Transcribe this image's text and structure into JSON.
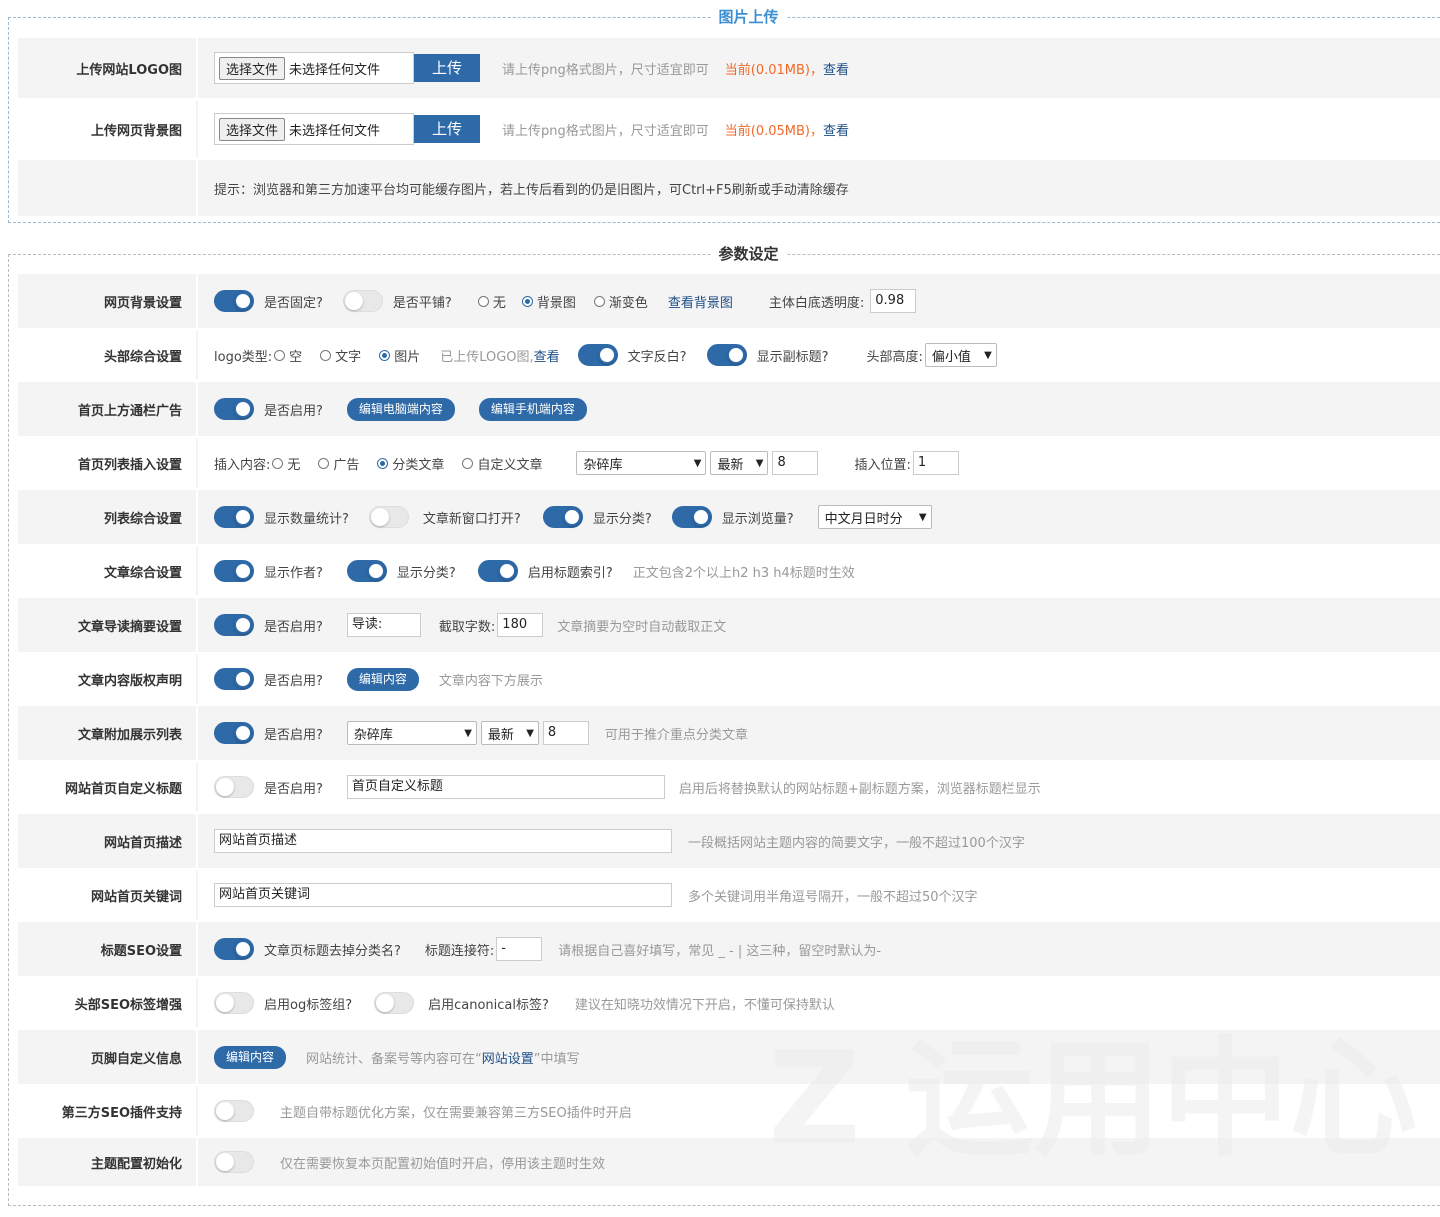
{
  "upload": {
    "legend": "图片上传",
    "logo": {
      "label": "上传网站LOGO图",
      "choose": "选择文件",
      "none": "未选择任何文件",
      "upload": "上传",
      "hint": "请上传png格式图片，尺寸适宜即可",
      "current": "当前(0.01MB)，",
      "view": "查看"
    },
    "bg": {
      "label": "上传网页背景图",
      "choose": "选择文件",
      "none": "未选择任何文件",
      "upload": "上传",
      "hint": "请上传png格式图片，尺寸适宜即可",
      "current": "当前(0.05MB)，",
      "view": "查看"
    },
    "tip": "提示：浏览器和第三方加速平台均可能缓存图片，若上传后看到的仍是旧图片，可Ctrl+F5刷新或手动清除缓存"
  },
  "params": {
    "legend": "参数设定",
    "r1": {
      "label": "网页背景设置",
      "fixed": "是否固定?",
      "tile": "是否平铺?",
      "none": "无",
      "img": "背景图",
      "grad": "渐变色",
      "view": "查看背景图",
      "opacity_label": "主体白底透明度:",
      "opacity": "0.98"
    },
    "r2": {
      "label": "头部综合设置",
      "logo_type": "logo类型:",
      "empty": "空",
      "text": "文字",
      "img": "图片",
      "uploaded": "已上传LOGO图,",
      "view": "查看",
      "invert": "文字反白?",
      "subtitle": "显示副标题?",
      "height_label": "头部高度:",
      "height": "偏小值"
    },
    "r3": {
      "label": "首页上方通栏广告",
      "enable": "是否启用?",
      "pc": "编辑电脑端内容",
      "mobile": "编辑手机端内容"
    },
    "r4": {
      "label": "首页列表插入设置",
      "insert": "插入内容:",
      "none": "无",
      "ad": "广告",
      "cat": "分类文章",
      "custom": "自定义文章",
      "category": "杂碎库",
      "order": "最新",
      "count": "8",
      "pos_label": "插入位置:",
      "pos": "1"
    },
    "r5": {
      "label": "列表综合设置",
      "stats": "显示数量统计?",
      "newwin": "文章新窗口打开?",
      "cat": "显示分类?",
      "views": "显示浏览量?",
      "datefmt": "中文月日时分"
    },
    "r6": {
      "label": "文章综合设置",
      "author": "显示作者?",
      "cat": "显示分类?",
      "toc": "启用标题索引?",
      "hint": "正文包含2个以上h2 h3 h4标题时生效"
    },
    "r7": {
      "label": "文章导读摘要设置",
      "enable": "是否启用?",
      "lead": "导读:",
      "len_label": "截取字数:",
      "len": "180",
      "hint": "文章摘要为空时自动截取正文"
    },
    "r8": {
      "label": "文章内容版权声明",
      "enable": "是否启用?",
      "edit": "编辑内容",
      "hint": "文章内容下方展示"
    },
    "r9": {
      "label": "文章附加展示列表",
      "enable": "是否启用?",
      "category": "杂碎库",
      "order": "最新",
      "count": "8",
      "hint": "可用于推介重点分类文章"
    },
    "r10": {
      "label": "网站首页自定义标题",
      "enable": "是否启用?",
      "value": "首页自定义标题",
      "hint": "启用后将替换默认的网站标题+副标题方案，浏览器标题栏显示"
    },
    "r11": {
      "label": "网站首页描述",
      "value": "网站首页描述",
      "hint": "一段概括网站主题内容的简要文字，一般不超过100个汉字"
    },
    "r12": {
      "label": "网站首页关键词",
      "value": "网站首页关键词",
      "hint": "多个关键词用半角逗号隔开，一般不超过50个汉字"
    },
    "r13": {
      "label": "标题SEO设置",
      "strip": "文章页标题去掉分类名?",
      "sep_label": "标题连接符:",
      "sep": "-",
      "hint": "请根据自己喜好填写，常见 _ - | 这三种，留空时默认为-"
    },
    "r14": {
      "label": "头部SEO标签增强",
      "og": "启用og标签组?",
      "canonical": "启用canonical标签?",
      "hint": "建议在知晓功效情况下开启，不懂可保持默认"
    },
    "r15": {
      "label": "页脚自定义信息",
      "edit": "编辑内容",
      "hint1": "网站统计、备案号等内容可在“",
      "link": "网站设置",
      "hint2": "”中填写"
    },
    "r16": {
      "label": "第三方SEO插件支持",
      "hint": "主题自带标题优化方案，仅在需要兼容第三方SEO插件时开启"
    },
    "r17": {
      "label": "主题配置初始化",
      "hint": "仅在需要恢复本页配置初始值时开启，停用该主题时生效"
    }
  },
  "watermark": "Z 运用中心",
  "colors": {
    "accent": "#2f6aa8",
    "orange": "#f06a2a",
    "legend_blue": "#3d8fd1"
  }
}
